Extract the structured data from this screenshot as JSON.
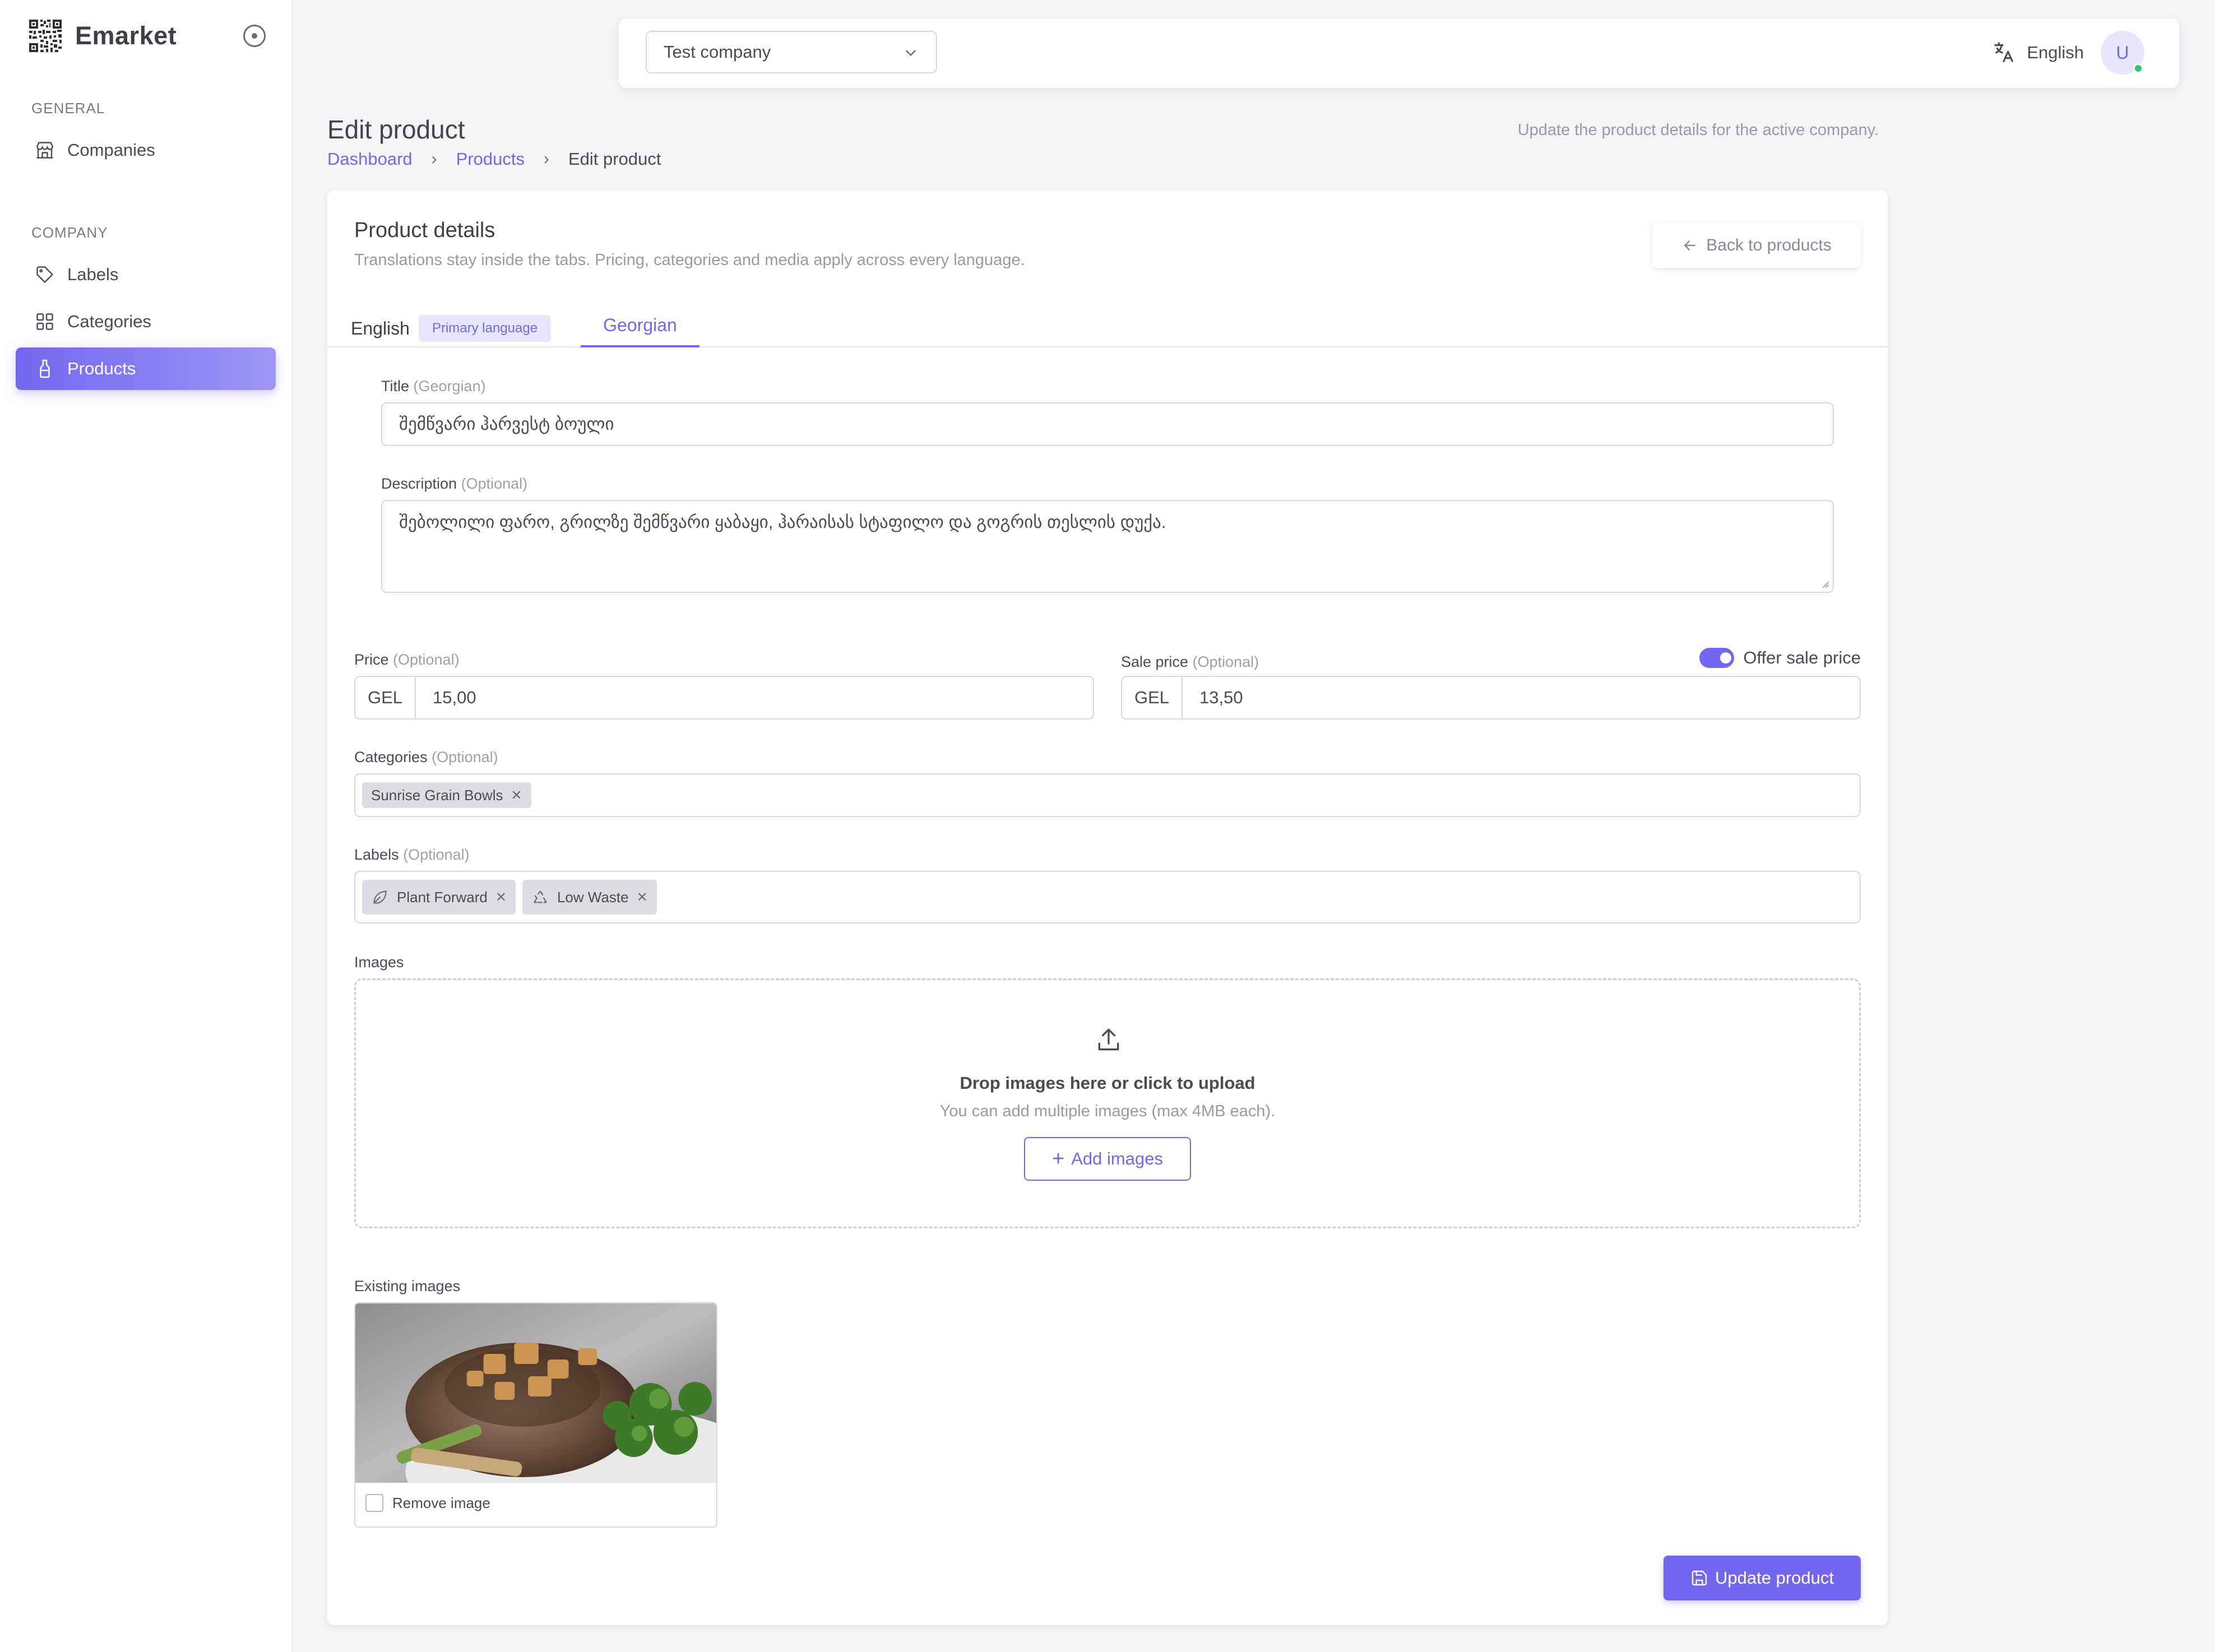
{
  "app": {
    "name": "Emarket"
  },
  "sidebar": {
    "general_title": "GENERAL",
    "company_title": "COMPANY",
    "items": [
      {
        "label": "Companies",
        "icon": "store-icon"
      },
      {
        "label": "Labels",
        "icon": "tag-icon"
      },
      {
        "label": "Categories",
        "icon": "grid-icon"
      },
      {
        "label": "Products",
        "icon": "bottle-icon",
        "active": true
      }
    ]
  },
  "topbar": {
    "company_select": "Test company",
    "language": "English",
    "avatar_initial": "U"
  },
  "page": {
    "title": "Edit product",
    "subtitle": "Update the product details for the active company.",
    "breadcrumb": [
      "Dashboard",
      "Products",
      "Edit product"
    ]
  },
  "card": {
    "title": "Product details",
    "description": "Translations stay inside the tabs. Pricing, categories and media apply across every language.",
    "back_button": "Back to products",
    "tabs": {
      "english": "English",
      "primary_badge": "Primary language",
      "georgian": "Georgian"
    },
    "title_field": {
      "label": "Title",
      "hint": "(Georgian)",
      "value": "შემწვარი ჰარვესტ ბოული"
    },
    "description_field": {
      "label": "Description",
      "hint": "(Optional)",
      "value": "შებოლილი ფარო, გრილზე შემწვარი ყაბაყი, ჰარაისას სტაფილო და გოგრის თესლის დუქა."
    },
    "price": {
      "label": "Price",
      "hint": "(Optional)",
      "currency": "GEL",
      "value": "15,00"
    },
    "sale_price": {
      "label": "Sale price",
      "hint": "(Optional)",
      "currency": "GEL",
      "value": "13,50"
    },
    "offer_toggle": {
      "label": "Offer sale price",
      "on": true
    },
    "categories": {
      "label": "Categories",
      "hint": "(Optional)",
      "chips": [
        "Sunrise Grain Bowls"
      ]
    },
    "labels": {
      "label": "Labels",
      "hint": "(Optional)",
      "chips": [
        {
          "text": "Plant Forward",
          "icon": "leaf-icon"
        },
        {
          "text": "Low Waste",
          "icon": "recycle-icon"
        }
      ]
    },
    "images": {
      "label": "Images",
      "drop_title": "Drop images here or click to upload",
      "drop_sub": "You can add multiple images (max 4MB each).",
      "add_button": "Add images"
    },
    "existing_images": {
      "label": "Existing images",
      "remove_label": "Remove image"
    },
    "update_button": "Update product"
  },
  "colors": {
    "accent": "#7367f0",
    "online": "#28c76f"
  }
}
